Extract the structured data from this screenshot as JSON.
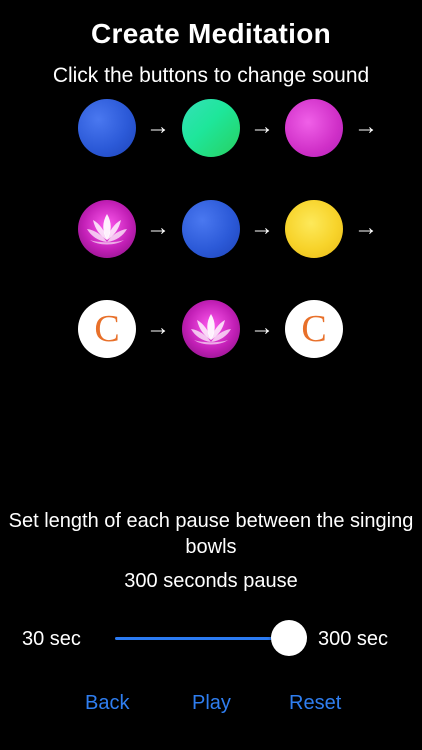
{
  "header": {
    "title": "Create Meditation",
    "subtitle": "Click the buttons to change sound"
  },
  "sequence": {
    "arrow": "→",
    "rows": [
      [
        "blue-orb",
        "green-orb",
        "magenta-orb"
      ],
      [
        "lotus-icon",
        "blue-orb",
        "yellow-orb"
      ],
      [
        "c-logo",
        "lotus-icon",
        "c-logo"
      ]
    ],
    "logo_letter": "C"
  },
  "pause": {
    "label": "Set length of each pause between the singing bowls",
    "value_text": "300 seconds pause",
    "min_label": "30 sec",
    "max_label": "300 sec",
    "min": 30,
    "max": 300,
    "value": 300
  },
  "buttons": {
    "back": "Back",
    "play": "Play",
    "reset": "Reset"
  },
  "colors": {
    "accent": "#2f7ef0",
    "background": "#000000"
  }
}
